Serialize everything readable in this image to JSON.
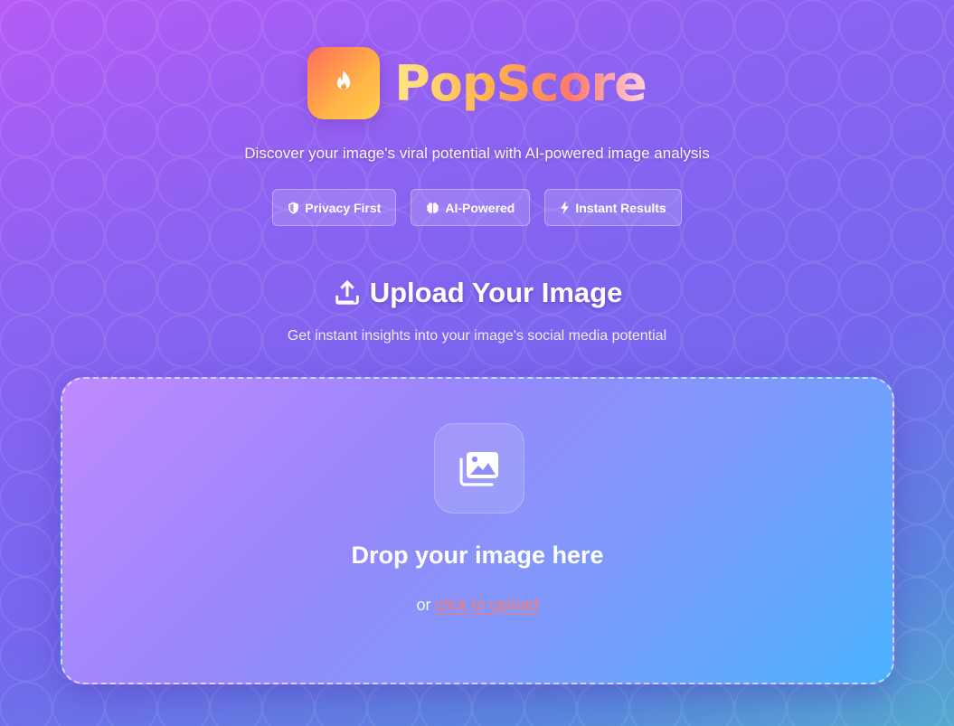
{
  "app": {
    "name": "PopScore",
    "tagline": "Discover your image's viral potential with AI-powered image analysis"
  },
  "badges": [
    {
      "label": "Privacy First",
      "icon": "shield-icon"
    },
    {
      "label": "AI-Powered",
      "icon": "brain-icon"
    },
    {
      "label": "Instant Results",
      "icon": "bolt-icon"
    }
  ],
  "upload": {
    "title": "Upload Your Image",
    "subtitle": "Get instant insights into your image's social media potential",
    "drop_title": "Drop your image here",
    "or_text": "or",
    "link_text": "click to upload"
  },
  "colors": {
    "brand_gradient_start": "#ff6e5a",
    "brand_gradient_end": "#ffd24a",
    "link": "#ff7a6a"
  }
}
